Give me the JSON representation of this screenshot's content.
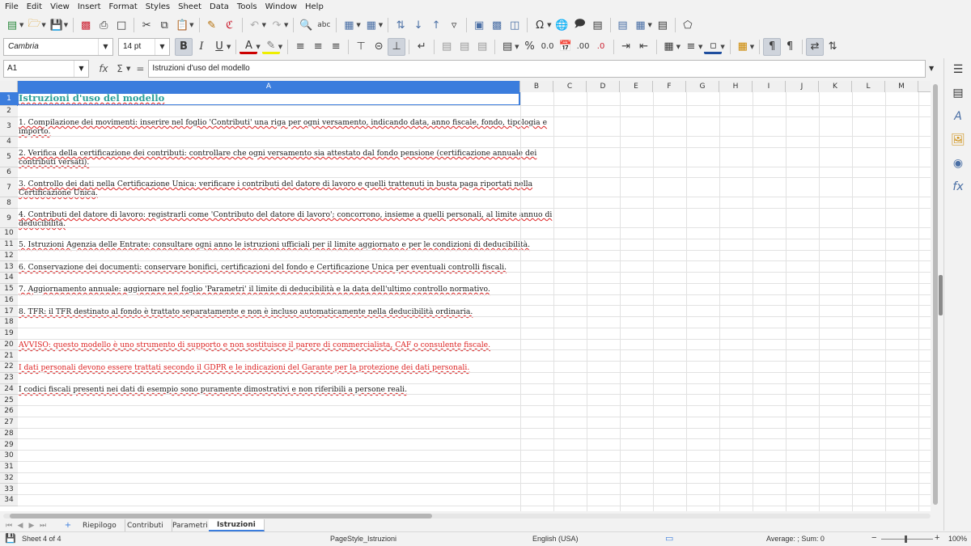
{
  "menu": [
    "File",
    "Edit",
    "View",
    "Insert",
    "Format",
    "Styles",
    "Sheet",
    "Data",
    "Tools",
    "Window",
    "Help"
  ],
  "toolbar": {
    "font_name": "Cambria",
    "font_size": "14 pt"
  },
  "formula_bar": {
    "cell_ref": "A1",
    "content": "Istruzioni d'uso del modello"
  },
  "columns": [
    "A",
    "B",
    "C",
    "D",
    "E",
    "F",
    "G",
    "H",
    "I",
    "J",
    "K",
    "L",
    "M"
  ],
  "rows": [
    "1",
    "2",
    "3",
    "4",
    "5",
    "6",
    "7",
    "8",
    "9",
    "10",
    "11",
    "12",
    "13",
    "14",
    "15",
    "16",
    "17",
    "18",
    "19",
    "20",
    "21",
    "22",
    "23",
    "24",
    "25",
    "26",
    "27",
    "28",
    "29",
    "30",
    "31",
    "32",
    "33",
    "34"
  ],
  "cells": {
    "r1": "Istruzioni d'uso del modello",
    "r3a": "1. Compilazione dei movimenti: inserire nel foglio 'Contributi' una riga per ogni versamento, indicando data, anno fiscale, fondo, tipologia e",
    "r3b": "importo.",
    "r5a": "2. Verifica della certificazione dei contributi: controllare che ogni versamento sia attestato dal fondo pensione (certificazione annuale dei",
    "r5b": "contributi versati).",
    "r7a": "3. Controllo dei dati nella Certificazione Unica: verificare i contributi del datore di lavoro e quelli trattenuti in busta paga riportati nella",
    "r7b": "Certificazione Unica.",
    "r9a": "4. Contributi del datore di lavoro: registrarli come 'Contributo del datore di lavoro'; concorrono, insieme a quelli personali, al limite annuo di",
    "r9b": "deducibilità.",
    "r11": "5. Istruzioni Agenzia delle Entrate: consultare ogni anno le istruzioni ufficiali per il limite aggiornato e per le condizioni di deducibilità.",
    "r13": "6. Conservazione dei documenti: conservare bonifici, certificazioni del fondo e Certificazione Unica per eventuali controlli fiscali.",
    "r15": "7. Aggiornamento annuale: aggiornare nel foglio 'Parametri' il limite di deducibilità e la data dell'ultimo controllo normativo.",
    "r17": "8. TFR: il TFR destinato al fondo è trattato separatamente e non è incluso automaticamente nella deducibilità ordinaria.",
    "r20": "AVVISO: questo modello è uno strumento di supporto e non sostituisce il parere di commercialista, CAF o consulente fiscale.",
    "r22": "I dati personali devono essere trattati secondo il GDPR e le indicazioni del Garante per la protezione dei dati personali.",
    "r24": "I codici fiscali presenti nei dati di esempio sono puramente dimostrativi e non riferibili a persone reali."
  },
  "sheet_tabs": [
    "Riepilogo",
    "Contributi",
    "Parametri",
    "Istruzioni"
  ],
  "active_sheet": "Istruzioni",
  "status": {
    "sheet_pos": "Sheet 4 of 4",
    "page_style": "PageStyle_Istruzioni",
    "language": "English (USA)",
    "summary": "Average: ; Sum: 0",
    "zoom": "100%"
  },
  "colors": {
    "accent": "#3b7ddd",
    "title_teal": "#2aa199",
    "warning_red": "#dd2222"
  }
}
